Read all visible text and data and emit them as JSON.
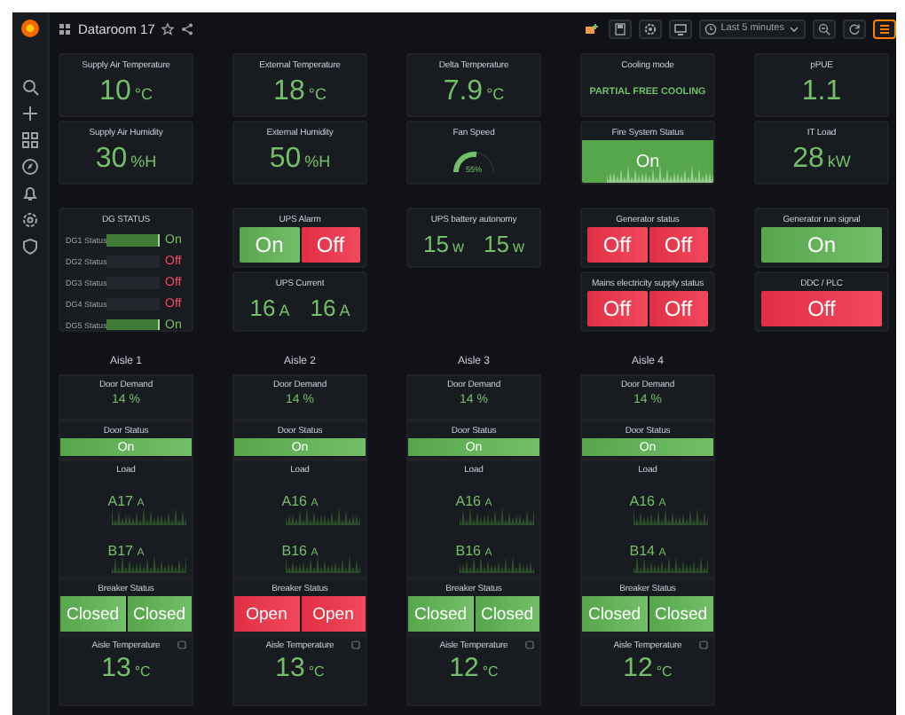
{
  "header": {
    "title": "Dataroom 17",
    "time_range": "Last 5 minutes"
  },
  "top_rows": [
    [
      {
        "title": "Supply Air Temperature",
        "kind": "value",
        "value": "10",
        "unit": "°C"
      },
      {
        "title": "External Temperature",
        "kind": "value",
        "value": "18",
        "unit": "°C"
      },
      {
        "title": "Delta Temperature",
        "kind": "value",
        "value": "7.9",
        "unit": "°C"
      },
      {
        "title": "Cooling mode",
        "kind": "text",
        "value": "PARTIAL FREE COOLING"
      },
      {
        "title": "pPUE",
        "kind": "value",
        "value": "1.1"
      }
    ],
    [
      {
        "title": "Supply Air Humidity",
        "kind": "value",
        "value": "30",
        "unit": "%H"
      },
      {
        "title": "External Humidity",
        "kind": "value",
        "value": "50",
        "unit": "%H"
      },
      {
        "title": "Fan Speed",
        "kind": "gauge",
        "reading": "55%"
      },
      {
        "title": "Fire System Status",
        "kind": "status",
        "value": "On",
        "alarm": false
      },
      {
        "title": "IT Load",
        "kind": "value",
        "value": "28",
        "unit": "kW"
      }
    ]
  ],
  "status_columns": [
    [
      {
        "title": "DG STATUS",
        "kind": "list",
        "items": [
          {
            "label": "DG1 Status",
            "value": "On",
            "on": true
          },
          {
            "label": "DG2 Status",
            "value": "Off",
            "on": false
          },
          {
            "label": "DG3 Status",
            "value": "Off",
            "on": false
          },
          {
            "label": "DG4 Status",
            "value": "Off",
            "on": false
          },
          {
            "label": "DG5 Status",
            "value": "On",
            "on": true
          }
        ]
      }
    ],
    [
      {
        "title": "UPS Alarm",
        "kind": "tiles",
        "items": [
          {
            "text": "On",
            "alarm": false
          },
          {
            "text": "Off",
            "alarm": true
          }
        ]
      },
      {
        "title": "UPS Current",
        "kind": "values",
        "items": [
          {
            "value": "16",
            "unit": "A"
          },
          {
            "value": "16",
            "unit": "A"
          }
        ]
      }
    ],
    [
      {
        "title": "UPS battery autonomy",
        "kind": "values",
        "items": [
          {
            "value": "15",
            "unit": "w"
          },
          {
            "value": "15",
            "unit": "w"
          }
        ]
      }
    ],
    [
      {
        "title": "Generator status",
        "kind": "tiles",
        "items": [
          {
            "text": "Off",
            "alarm": true
          },
          {
            "text": "Off",
            "alarm": true
          }
        ]
      },
      {
        "title": "Mains electricity supply status",
        "kind": "tiles",
        "items": [
          {
            "text": "Off",
            "alarm": true
          },
          {
            "text": "Off",
            "alarm": true
          }
        ]
      }
    ],
    [
      {
        "title": "Generator run signal",
        "kind": "tiles",
        "items": [
          {
            "text": "On",
            "alarm": false
          }
        ]
      },
      {
        "title": "DDC / PLC",
        "kind": "tiles",
        "items": [
          {
            "text": "Off",
            "alarm": true
          }
        ]
      }
    ]
  ],
  "aisles": [
    {
      "label": "Aisle 1",
      "door_demand": {
        "title": "Door Demand",
        "value": "14 %"
      },
      "door_status": {
        "title": "Door Status",
        "text": "On",
        "alarm": false
      },
      "load": {
        "title": "Load",
        "series": [
          {
            "label": "A",
            "value": "17",
            "unit": "A"
          },
          {
            "label": "B",
            "value": "17",
            "unit": "A"
          }
        ]
      },
      "breaker": {
        "title": "Breaker Status",
        "tiles": [
          {
            "text": "Closed",
            "alarm": false
          },
          {
            "text": "Closed",
            "alarm": false
          }
        ]
      },
      "temperature": {
        "title": "Aisle Temperature",
        "value": "13",
        "unit": "°C"
      }
    },
    {
      "label": "Aisle 2",
      "door_demand": {
        "title": "Door Demand",
        "value": "14 %"
      },
      "door_status": {
        "title": "Door Status",
        "text": "On",
        "alarm": false
      },
      "load": {
        "title": "Load",
        "series": [
          {
            "label": "A",
            "value": "16",
            "unit": "A"
          },
          {
            "label": "B",
            "value": "16",
            "unit": "A"
          }
        ]
      },
      "breaker": {
        "title": "Breaker Status",
        "tiles": [
          {
            "text": "Open",
            "alarm": true
          },
          {
            "text": "Open",
            "alarm": true
          }
        ]
      },
      "temperature": {
        "title": "Aisle Temperature",
        "value": "13",
        "unit": "°C"
      }
    },
    {
      "label": "Aisle 3",
      "door_demand": {
        "title": "Door Demand",
        "value": "14 %"
      },
      "door_status": {
        "title": "Door Status",
        "text": "On",
        "alarm": false
      },
      "load": {
        "title": "Load",
        "series": [
          {
            "label": "A",
            "value": "16",
            "unit": "A"
          },
          {
            "label": "B",
            "value": "16",
            "unit": "A"
          }
        ]
      },
      "breaker": {
        "title": "Breaker Status",
        "tiles": [
          {
            "text": "Closed",
            "alarm": false
          },
          {
            "text": "Closed",
            "alarm": false
          }
        ]
      },
      "temperature": {
        "title": "Aisle Temperature",
        "value": "12",
        "unit": "°C"
      }
    },
    {
      "label": "Aisle 4",
      "door_demand": {
        "title": "Door Demand",
        "value": "14 %"
      },
      "door_status": {
        "title": "Door Status",
        "text": "On",
        "alarm": false
      },
      "load": {
        "title": "Load",
        "series": [
          {
            "label": "A",
            "value": "16",
            "unit": "A"
          },
          {
            "label": "B",
            "value": "14",
            "unit": "A"
          }
        ]
      },
      "breaker": {
        "title": "Breaker Status",
        "tiles": [
          {
            "text": "Closed",
            "alarm": false
          },
          {
            "text": "Closed",
            "alarm": false
          }
        ]
      },
      "temperature": {
        "title": "Aisle Temperature",
        "value": "12",
        "unit": "°C"
      }
    }
  ]
}
